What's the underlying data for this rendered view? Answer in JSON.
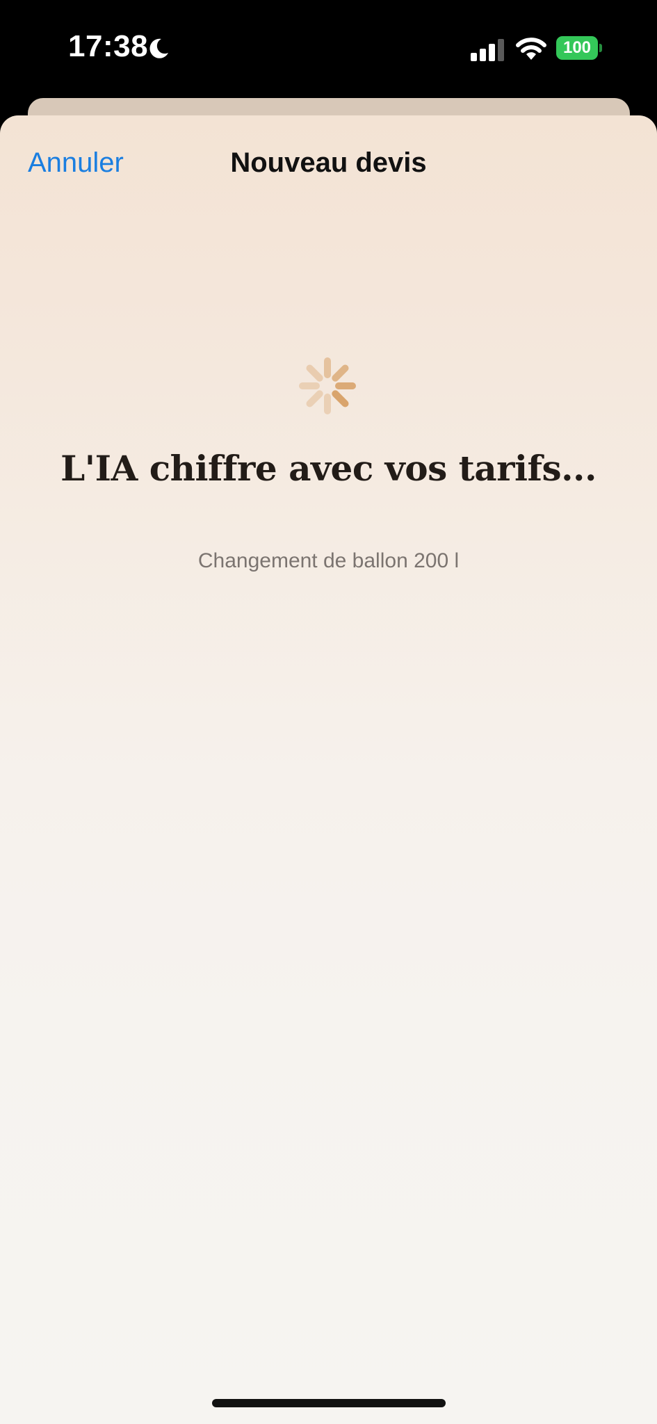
{
  "status_bar": {
    "time": "17:38",
    "battery": "100",
    "icons": [
      "moon-icon",
      "cellular-signal-icon",
      "wifi-icon",
      "battery-icon"
    ]
  },
  "sheet": {
    "cancel_label": "Annuler",
    "title": "Nouveau devis"
  },
  "loading": {
    "spinner_icon": "activity-spinner-icon",
    "title": "L'IA chiffre avec vos tarifs...",
    "subtitle": "Changement de ballon 200 l"
  },
  "colors": {
    "accent": "#1a7ee0",
    "battery_green": "#34c759",
    "spinner": "#d9a46c",
    "background_top": "#f3e3d4",
    "background_bottom": "#f6f4f1"
  }
}
